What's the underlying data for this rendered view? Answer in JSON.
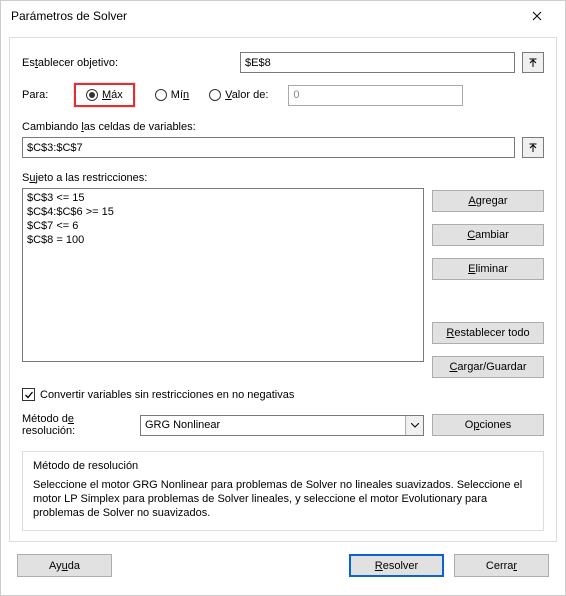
{
  "window": {
    "title": "Parámetros de Solver"
  },
  "objective": {
    "label": "Establecer objetivo:",
    "value": "$E$8"
  },
  "target": {
    "for_label": "Para:",
    "max": "Máx",
    "min": "Mín",
    "value_of": "Valor de:",
    "value_placeholder": "0",
    "selected": "max"
  },
  "variables": {
    "label": "Cambiando las celdas de variables:",
    "value": "$C$3:$C$7"
  },
  "constraints": {
    "label": "Sujeto a las restricciones:",
    "items": [
      "$C$3 <= 15",
      "$C$4:$C$6 >= 15",
      "$C$7 <= 6",
      "$C$8 = 100"
    ]
  },
  "side_buttons": {
    "add": "Agregar",
    "change": "Cambiar",
    "delete": "Eliminar",
    "reset": "Restablecer todo",
    "load_save": "Cargar/Guardar"
  },
  "nonneg": {
    "label": "Convertir variables sin restricciones en no negativas",
    "checked": true
  },
  "method": {
    "label": "Método de resolución:",
    "selected": "GRG Nonlinear",
    "options_button": "Opciones"
  },
  "description": {
    "title": "Método de resolución",
    "text": "Seleccione el motor GRG Nonlinear para problemas de Solver no lineales suavizados. Seleccione el motor LP Simplex para problemas de Solver lineales, y seleccione el motor Evolutionary para problemas de Solver no suavizados."
  },
  "bottom": {
    "help": "Ayuda",
    "solve": "Resolver",
    "close": "Cerrar"
  }
}
